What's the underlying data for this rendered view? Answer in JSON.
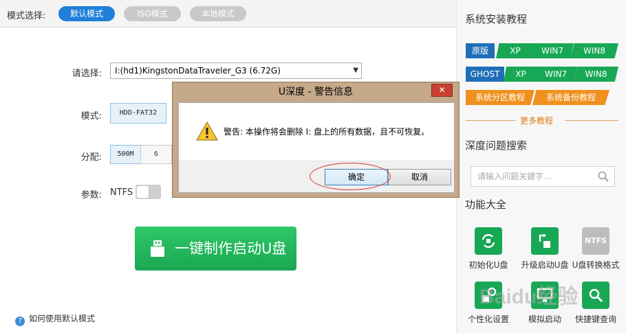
{
  "modebar": {
    "label": "模式选择:",
    "modes": [
      {
        "label": "默认模式",
        "active": true
      },
      {
        "label": "ISO模式",
        "active": false
      },
      {
        "label": "本地模式",
        "active": false
      }
    ]
  },
  "form": {
    "select_label": "请选择:",
    "select_value": "I:(hd1)KingstonDataTraveler_G3 (6.72G)",
    "mode_label": "模式:",
    "mode_value": "HDD-FAT32",
    "partition_label": "分配:",
    "partition_options": [
      "500M",
      "6"
    ],
    "param_label": "参数:",
    "param_value": "NTFS",
    "make_button": "一键制作启动U盘",
    "help_link": "如何使用默认模式"
  },
  "dialog": {
    "title": "U深度 - 警告信息",
    "close": "✕",
    "message": "警告: 本操作将会删除 I: 盘上的所有数据，且不可恢复。",
    "ok": "确定",
    "cancel": "取消"
  },
  "right_panel": {
    "tutorial_title": "系统安装教程",
    "row1": [
      "原版",
      "XP",
      "WIN7",
      "WIN8"
    ],
    "row2": [
      "GHOST",
      "XP",
      "WIN7",
      "WIN8"
    ],
    "row3": [
      "系统分区教程",
      "系统备份教程"
    ],
    "more": "更多教程",
    "search_title": "深度问题搜索",
    "search_placeholder": "请输入问题关键字...",
    "functions_title": "功能大全",
    "functions": [
      {
        "label": "初始化U盘",
        "icon": "usb-refresh-icon"
      },
      {
        "label": "升级启动U盘",
        "icon": "usb-upgrade-icon"
      },
      {
        "label": "U盘转换格式",
        "icon": "ntfs-icon",
        "icon_text": "NTFS"
      },
      {
        "label": "个性化设置",
        "icon": "personalize-icon"
      },
      {
        "label": "模拟启动",
        "icon": "simulate-icon"
      },
      {
        "label": "快捷键查询",
        "icon": "shortcut-search-icon"
      }
    ]
  },
  "colors": {
    "accent_blue": "#1f7fd9",
    "green": "#18a855",
    "orange": "#f0901e",
    "dialog_frame": "#c6a98a",
    "close_red": "#c84031"
  },
  "watermark": "Baidu经验"
}
